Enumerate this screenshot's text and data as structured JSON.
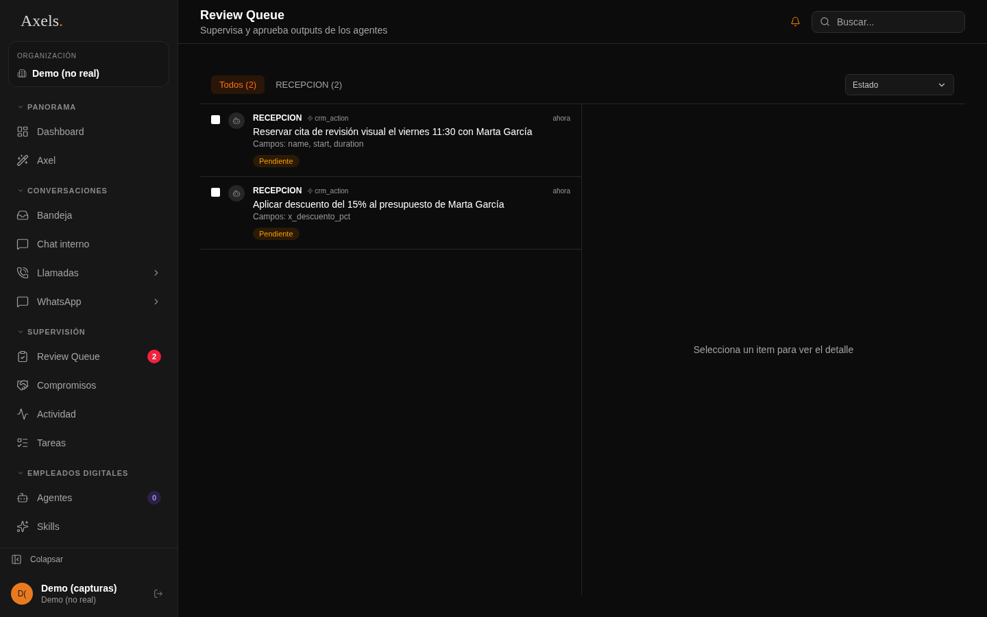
{
  "sidebar": {
    "logo": {
      "name": "Axels",
      "dot": "."
    },
    "organization": {
      "label": "ORGANIZACIÓN",
      "name": "Demo (no real)"
    },
    "sections": [
      {
        "title": "PANORAMA",
        "expanded": true,
        "items": [
          {
            "label": "Dashboard",
            "submenu": false
          },
          {
            "label": "Axel",
            "submenu": false
          }
        ]
      },
      {
        "title": "CONVERSACIONES",
        "expanded": true,
        "items": [
          {
            "label": "Bandeja",
            "submenu": false
          },
          {
            "label": "Chat interno",
            "submenu": false
          },
          {
            "label": "Llamadas",
            "submenu": true
          },
          {
            "label": "WhatsApp",
            "submenu": true
          }
        ]
      },
      {
        "title": "SUPERVISIÓN",
        "expanded": true,
        "items": [
          {
            "label": "Review Queue",
            "submenu": false,
            "badge": {
              "text": "2",
              "kind": "alert"
            }
          },
          {
            "label": "Compromisos",
            "submenu": false
          },
          {
            "label": "Actividad",
            "submenu": false
          },
          {
            "label": "Tareas",
            "submenu": false
          }
        ]
      },
      {
        "title": "EMPLEADOS DIGITALES",
        "expanded": true,
        "items": [
          {
            "label": "Agentes",
            "submenu": false,
            "badge": {
              "text": "0",
              "kind": "info"
            }
          },
          {
            "label": "Skills",
            "submenu": false
          }
        ]
      }
    ],
    "collapse": "Colapsar",
    "user": {
      "initials": "D(",
      "name": "Demo (capturas)",
      "org": "Demo (no real)"
    }
  },
  "header": {
    "title": "Review Queue",
    "subtitle": "Supervisa y aprueba outputs de los agentes",
    "search": {
      "placeholder": "Buscar..."
    }
  },
  "tabs": [
    {
      "label": "Todos (2)",
      "selected": true
    },
    {
      "label": "RECEPCION (2)",
      "selected": false
    }
  ],
  "filter": {
    "value": "Estado"
  },
  "items": [
    {
      "checked": false,
      "source": "RECEPCION",
      "action": "crm_action",
      "time": "ahora",
      "title": "Reservar cita de revisión visual el viernes 11:30 con Marta García",
      "fields": "Campos: name, start, duration",
      "status": {
        "label": "Pendiente",
        "kind": "pending"
      }
    },
    {
      "checked": false,
      "source": "RECEPCION",
      "action": "crm_action",
      "time": "ahora",
      "title": "Aplicar descuento del 15% al presupuesto de Marta García",
      "fields": "Campos: x_descuento_pct",
      "status": {
        "label": "Pendiente",
        "kind": "pending"
      }
    }
  ],
  "detail": {
    "empty_text": "Selecciona un item para ver el detalle"
  }
}
